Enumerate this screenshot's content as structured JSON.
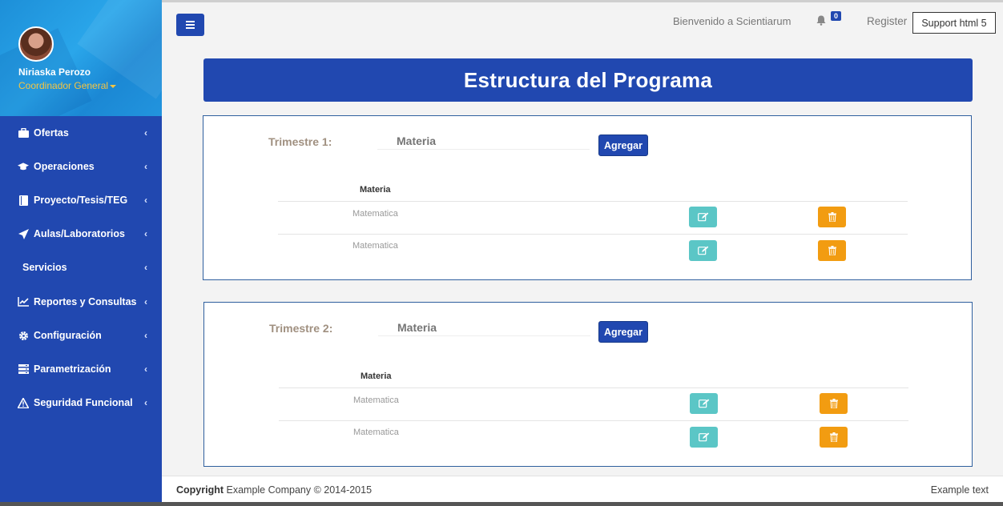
{
  "profile": {
    "name": "Niriaska Perozo",
    "role": "Coordinador General"
  },
  "sidebar": {
    "items": [
      {
        "label": "Ofertas",
        "icon": "briefcase-icon"
      },
      {
        "label": "Operaciones",
        "icon": "graduation-cap-icon"
      },
      {
        "label": "Proyecto/Tesis/TEG",
        "icon": "book-icon"
      },
      {
        "label": "Aulas/Laboratorios",
        "icon": "paper-plane-icon"
      },
      {
        "label": "Servicios",
        "icon": ""
      },
      {
        "label": "Reportes y Consultas",
        "icon": "line-chart-icon"
      },
      {
        "label": "Configuración",
        "icon": "gear-icon"
      },
      {
        "label": "Parametrización",
        "icon": "server-icon"
      },
      {
        "label": "Seguridad Funcional",
        "icon": "warning-icon"
      }
    ],
    "chevron": "‹"
  },
  "topbar": {
    "welcome": "Bienvenido a Scientiarum",
    "notifications_count": "0",
    "register": "Register",
    "support": "Support html 5"
  },
  "main": {
    "title": "Estructura del Programa",
    "panels": [
      {
        "label": "Trimestre 1:",
        "input_placeholder": "Materia",
        "add_label": "Agregar",
        "column_header": "Materia",
        "rows": [
          "Matematica",
          "Matematica"
        ]
      },
      {
        "label": "Trimestre 2:",
        "input_placeholder": "Materia",
        "add_label": "Agregar",
        "column_header": "Materia",
        "rows": [
          "Matematica",
          "Matematica"
        ]
      }
    ]
  },
  "footer": {
    "copyright_bold": "Copyright",
    "copyright_text": " Example Company © 2014-2015",
    "right_text": "Example text"
  },
  "colors": {
    "primary": "#2148b0",
    "edit": "#5bc6c6",
    "delete": "#f29c11",
    "role": "#f5c542"
  }
}
